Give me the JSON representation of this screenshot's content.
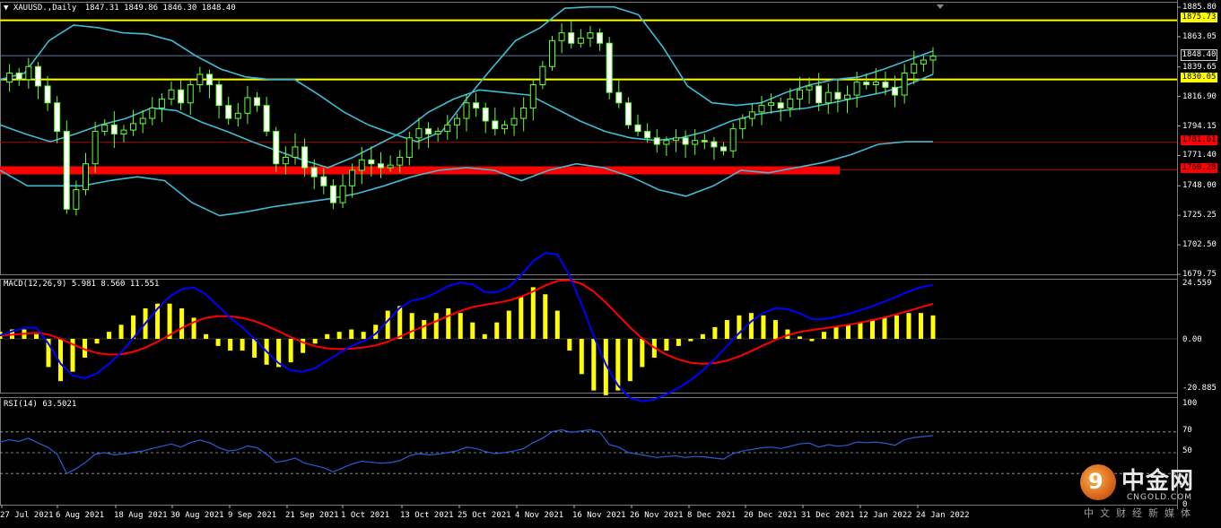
{
  "header": {
    "symbol_title": "XAUUSD.,Daily",
    "ohlc": "1847.31 1849.86 1846.30 1848.40"
  },
  "macd_label": "MACD(12,26,9) 5.981 8.560 11.551",
  "rsi_label": "RSI(14) 63.5021",
  "price_axis": [
    "1885.80",
    "1863.05",
    "1839.65",
    "1816.90",
    "1794.15",
    "1771.40",
    "1748.00",
    "1725.25",
    "1702.50",
    "1679.75"
  ],
  "price_tags": {
    "current": "1848.40",
    "resistance_high": "1875.73",
    "resistance_mid": "1830.05",
    "support_high": "1781.61",
    "support_low": "1760.28"
  },
  "macd_axis": [
    "24.559",
    "0.00",
    "-20.885"
  ],
  "rsi_axis": [
    "100",
    "70",
    "50",
    "0"
  ],
  "x_axis": [
    "27 Jul 2021",
    "6 Aug 2021",
    "18 Aug 2021",
    "30 Aug 2021",
    "9 Sep 2021",
    "21 Sep 2021",
    "1 Oct 2021",
    "13 Oct 2021",
    "25 Oct 2021",
    "4 Nov 2021",
    "16 Nov 2021",
    "26 Nov 2021",
    "8 Dec 2021",
    "20 Dec 2021",
    "31 Dec 2021",
    "12 Jan 2022",
    "24 Jan 2022"
  ],
  "logo": {
    "mark": "9",
    "name": "中金网",
    "site": "CNGOLD.COM",
    "tagline": "中文财经新媒体"
  },
  "colors": {
    "background": "#000000",
    "bull_candle": "#000000",
    "candle_outline": "#66ff33",
    "bollinger": "#3fbcd4",
    "yellow_level": "#ffff00",
    "red_level": "#ff0000",
    "macd_hist": "#ffff00",
    "macd_line": "#0000ff",
    "signal_line": "#ff0000",
    "rsi_line": "#2a5bd7",
    "grid": "#555555"
  },
  "chart_data": {
    "type": "candlestick",
    "symbol": "XAUUSD",
    "timeframe": "Daily",
    "last": {
      "open": 1847.31,
      "high": 1849.86,
      "low": 1846.3,
      "close": 1848.4
    },
    "price_range": [
      1679.75,
      1885.8
    ],
    "levels": [
      {
        "price": 1875.73,
        "color": "yellow"
      },
      {
        "price": 1830.05,
        "color": "yellow"
      },
      {
        "price": 1781.61,
        "color": "red"
      },
      {
        "price": 1760.28,
        "color": "red"
      }
    ],
    "close_path": [
      1828,
      1835,
      1830,
      1840,
      1825,
      1812,
      1790,
      1730,
      1745,
      1765,
      1790,
      1795,
      1788,
      1791,
      1796,
      1800,
      1808,
      1815,
      1822,
      1812,
      1826,
      1834,
      1826,
      1810,
      1800,
      1804,
      1816,
      1810,
      1790,
      1765,
      1770,
      1778,
      1762,
      1755,
      1748,
      1735,
      1748,
      1760,
      1768,
      1765,
      1762,
      1764,
      1770,
      1785,
      1792,
      1788,
      1790,
      1795,
      1800,
      1812,
      1808,
      1798,
      1792,
      1795,
      1800,
      1808,
      1826,
      1840,
      1860,
      1866,
      1858,
      1862,
      1866,
      1858,
      1820,
      1812,
      1795,
      1790,
      1785,
      1780,
      1783,
      1785,
      1780,
      1783,
      1782,
      1778,
      1775,
      1792,
      1800,
      1805,
      1810,
      1812,
      1808,
      1815,
      1822,
      1825,
      1812,
      1820,
      1815,
      1818,
      1828,
      1826,
      1828,
      1824,
      1818,
      1835,
      1842,
      1845,
      1848
    ],
    "bollinger_upper": [
      1830,
      1835,
      1860,
      1872,
      1870,
      1866,
      1865,
      1860,
      1848,
      1838,
      1832,
      1830,
      1830,
      1818,
      1805,
      1795,
      1788,
      1782,
      1790,
      1815,
      1838,
      1860,
      1870,
      1885,
      1886,
      1886,
      1880,
      1855,
      1825,
      1812,
      1810,
      1812,
      1820,
      1826,
      1830,
      1832,
      1838,
      1845,
      1852
    ],
    "bollinger_middle": [
      1795,
      1788,
      1782,
      1788,
      1795,
      1800,
      1808,
      1806,
      1797,
      1790,
      1782,
      1775,
      1768,
      1762,
      1770,
      1780,
      1790,
      1805,
      1815,
      1822,
      1820,
      1818,
      1808,
      1798,
      1790,
      1785,
      1783,
      1785,
      1790,
      1798,
      1803,
      1806,
      1808,
      1812,
      1816,
      1820,
      1826,
      1834
    ],
    "bollinger_lower": [
      1760,
      1748,
      1748,
      1748,
      1752,
      1755,
      1752,
      1735,
      1725,
      1728,
      1732,
      1735,
      1738,
      1742,
      1748,
      1755,
      1760,
      1762,
      1760,
      1752,
      1760,
      1765,
      1762,
      1755,
      1745,
      1740,
      1748,
      1760,
      1758,
      1762,
      1766,
      1772,
      1780,
      1782,
      1782
    ],
    "macd_histogram": [
      3,
      4,
      4,
      2,
      -12,
      -18,
      -14,
      -8,
      -2,
      3,
      6,
      10,
      13,
      15,
      15,
      13,
      9,
      2,
      -3,
      -5,
      -5,
      -8,
      -11,
      -12,
      -10,
      -6,
      -2,
      2,
      3,
      4,
      3,
      6,
      12,
      14,
      11,
      8,
      11,
      13,
      11,
      7,
      2,
      7,
      12,
      18,
      22,
      19,
      12,
      -5,
      -15,
      -22,
      -24,
      -22,
      -18,
      -12,
      -8,
      -5,
      -3,
      -1,
      2,
      5,
      8,
      10,
      11,
      10,
      8,
      4,
      1,
      -1,
      3,
      5,
      6,
      7,
      8,
      9,
      10,
      11,
      11,
      10
    ]
  }
}
